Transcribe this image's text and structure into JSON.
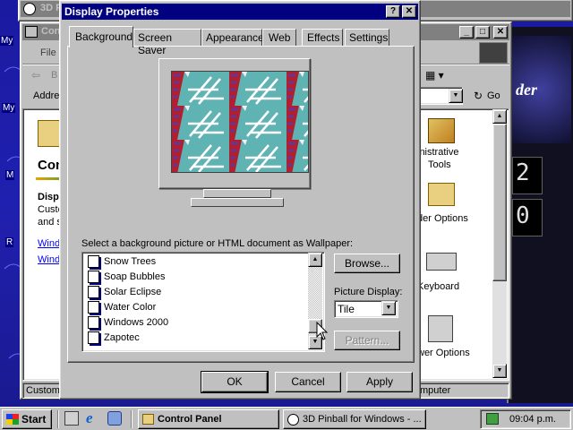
{
  "desktop": {
    "labels": [
      "My",
      "My",
      "M",
      "R"
    ]
  },
  "pinball_window": {
    "title": "3D P"
  },
  "control_panel": {
    "title": "Con",
    "menu_file": "File",
    "back_label": "B",
    "address_label": "Addre",
    "go_label": "Go",
    "heading": "Con",
    "desc_title": "Displ",
    "desc_line1": "Custo",
    "desc_line2": "and s",
    "link1": "Wind",
    "link2": "Wind",
    "status_left": "Customi",
    "status_right": "mputer",
    "icons": [
      {
        "line1": "inistrative",
        "line2": "Tools"
      },
      {
        "line1": "der Options",
        "line2": ""
      },
      {
        "line1": "Keyboard",
        "line2": ""
      },
      {
        "line1": "wer Options",
        "line2": ""
      }
    ]
  },
  "pinball_side": {
    "digit1": "2",
    "digit2": "0",
    "logo_text": "der"
  },
  "dialog": {
    "title": "Display Properties",
    "help_btn": "?",
    "close_btn": "✕",
    "tabs": [
      "Background",
      "Screen Saver",
      "Appearance",
      "Web",
      "Effects",
      "Settings"
    ],
    "wallpaper_label": "Select a background picture or HTML document as Wallpaper:",
    "wallpapers": [
      "Snow Trees",
      "Soap Bubbles",
      "Solar Eclipse",
      "Water Color",
      "Windows 2000",
      "Zapotec"
    ],
    "browse_label": "Browse...",
    "picture_display_label": "Picture Display:",
    "picture_display_value": "Tile",
    "pattern_label": "Pattern...",
    "ok_label": "OK",
    "cancel_label": "Cancel",
    "apply_label": "Apply"
  },
  "taskbar": {
    "start_label": "Start",
    "tasks": [
      "Control Panel",
      "3D Pinball for Windows - ..."
    ],
    "clock": "09:04 p.m."
  },
  "colors": {
    "title_active": "#000080",
    "face": "#c0c0c0",
    "preview_bg": "#5fb3b3"
  }
}
